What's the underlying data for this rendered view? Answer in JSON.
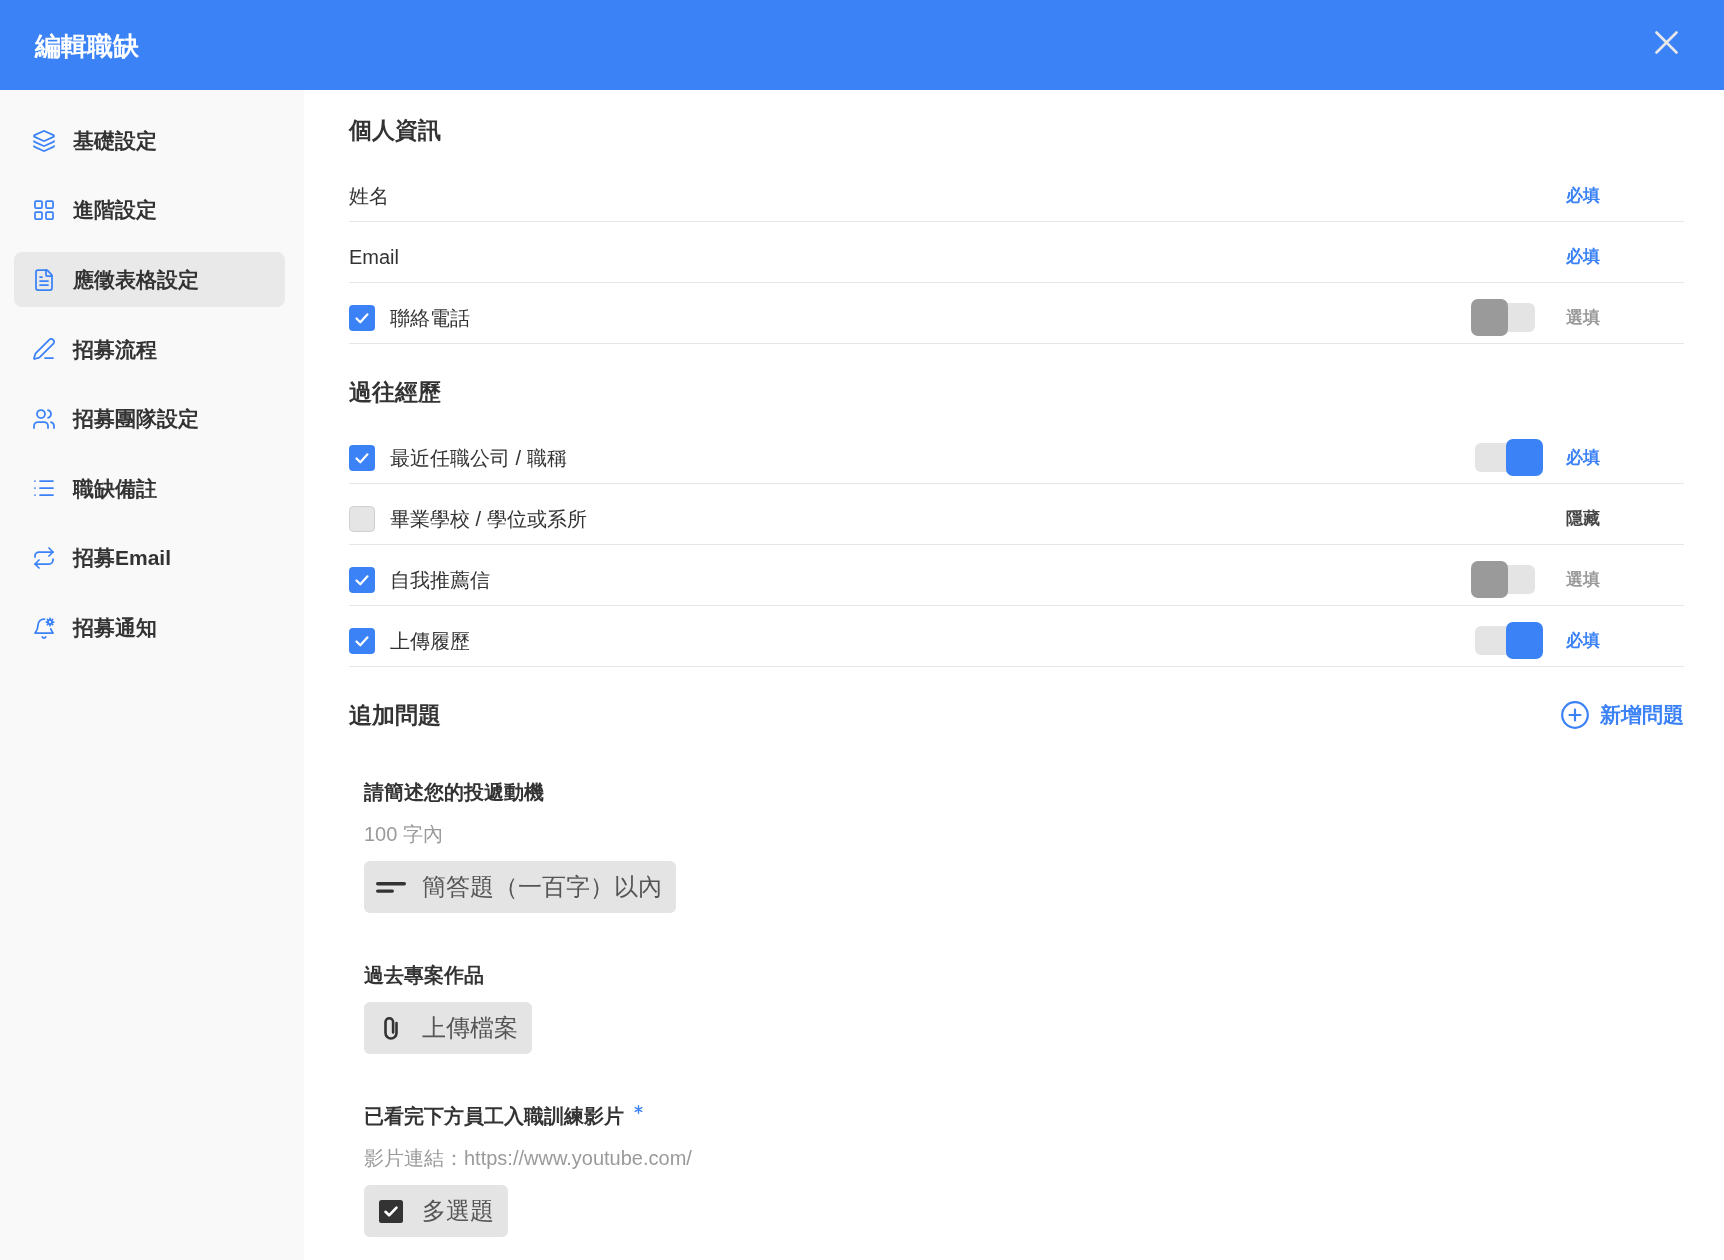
{
  "dialog": {
    "title": "編輯職缺"
  },
  "sidebar": {
    "items": [
      {
        "label": "基礎設定",
        "selected": false
      },
      {
        "label": "進階設定",
        "selected": false
      },
      {
        "label": "應徵表格設定",
        "selected": true
      },
      {
        "label": "招募流程",
        "selected": false
      },
      {
        "label": "招募團隊設定",
        "selected": false
      },
      {
        "label": "職缺備註",
        "selected": false
      },
      {
        "label": "招募Email",
        "selected": false
      },
      {
        "label": "招募通知",
        "selected": false
      }
    ]
  },
  "form_sections": [
    {
      "title": "個人資訊",
      "fields": [
        {
          "kind": "fixed",
          "label": "姓名",
          "status": "必填"
        },
        {
          "kind": "fixed",
          "label": "Email",
          "status": "必填"
        },
        {
          "kind": "optional",
          "label": "聯絡電話",
          "checked": true,
          "required": false,
          "status": "選填"
        }
      ]
    },
    {
      "title": "過往經歷",
      "fields": [
        {
          "kind": "optional",
          "label": "最近任職公司 / 職稱",
          "checked": true,
          "required": true,
          "status": "必填"
        },
        {
          "kind": "optional",
          "label": "畢業學校 / 學位或系所",
          "checked": false,
          "status": "隱藏"
        },
        {
          "kind": "optional",
          "label": "自我推薦信",
          "checked": true,
          "required": false,
          "status": "選填"
        },
        {
          "kind": "optional",
          "label": "上傳履歷",
          "checked": true,
          "required": true,
          "status": "必填"
        }
      ]
    }
  ],
  "additional_questions": {
    "title": "追加問題",
    "add_button": "新增問題",
    "questions": [
      {
        "title": "請簡述您的投遞動機",
        "required": false,
        "description": "100 字內",
        "answer_type": {
          "kind": "short_text",
          "label": "簡答題（一百字）以內"
        }
      },
      {
        "title": "過去專案作品",
        "required": false,
        "answer_type": {
          "kind": "file",
          "label": "上傳檔案"
        }
      },
      {
        "title": "已看完下方員工入職訓練影片",
        "required": true,
        "description": "影片連結：https://www.youtube.com/",
        "answer_type": {
          "kind": "multiple_choice",
          "label": "多選題"
        }
      }
    ]
  }
}
